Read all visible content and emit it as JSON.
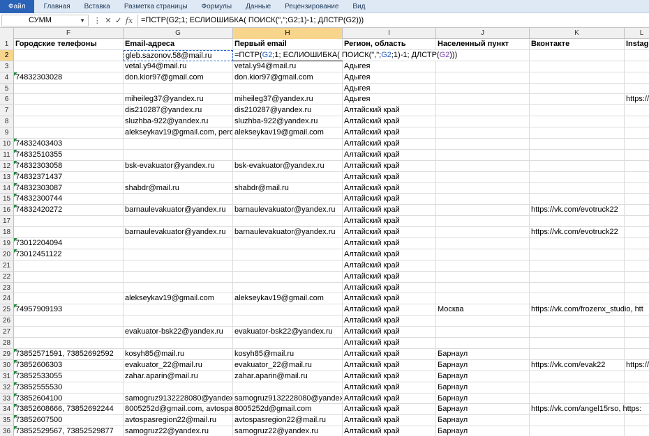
{
  "ribbon": {
    "tabs": [
      "Файл",
      "Главная",
      "Вставка",
      "Разметка страницы",
      "Формулы",
      "Данные",
      "Рецензирование",
      "Вид"
    ]
  },
  "formula_bar": {
    "name_box": "СУММ",
    "cancel": "✕",
    "enter": "✓",
    "fx": "fx",
    "formula": "=ПСТР(G2;1; ЕСЛИОШИБКА( ПОИСК(\",\";G2;1)-1; ДЛСТР(G2)))"
  },
  "columns": [
    "F",
    "G",
    "H",
    "I",
    "J",
    "K",
    "L"
  ],
  "header_row": {
    "F": "Городские телефоны",
    "G": "Email-адреса",
    "H": "Первый email",
    "I": "Регион, область",
    "J": "Населенный пункт",
    "K": "Вконтакте",
    "L": "Instagram"
  },
  "edit_cell_text": "=ПСТР(G2;1; ЕСЛИОШИБКА( ПОИСК(\",\";G2;1)-1; ДЛСТР(G2)))",
  "rows": [
    {
      "n": "2",
      "F": "",
      "G": "gleb.sazonov.58@mail.ru",
      "H": "",
      "I": "",
      "J": "",
      "K": "",
      "L": ""
    },
    {
      "n": "3",
      "F": "",
      "G": "vetal.y94@mail.ru",
      "H": "vetal.y94@mail.ru",
      "I": "Адыгея",
      "J": "",
      "K": "",
      "L": ""
    },
    {
      "n": "4",
      "F": "74832303028",
      "G": "don.kior97@gmail.com",
      "H": "don.kior97@gmail.com",
      "I": "Адыгея",
      "J": "",
      "K": "",
      "L": ""
    },
    {
      "n": "5",
      "F": "",
      "G": "",
      "H": "",
      "I": "Адыгея",
      "J": "",
      "K": "",
      "L": ""
    },
    {
      "n": "6",
      "F": "",
      "G": "miheileg37@yandex.ru",
      "H": "miheileg37@yandex.ru",
      "I": "Адыгея",
      "J": "",
      "K": "",
      "L": "https://"
    },
    {
      "n": "7",
      "F": "",
      "G": "dis210287@yandex.ru",
      "H": "dis210287@yandex.ru",
      "I": "Алтайский край",
      "J": "",
      "K": "",
      "L": ""
    },
    {
      "n": "8",
      "F": "",
      "G": "sluzhba-922@yandex.ru",
      "H": "sluzhba-922@yandex.ru",
      "I": "Алтайский край",
      "J": "",
      "K": "",
      "L": ""
    },
    {
      "n": "9",
      "F": "",
      "G": "alekseykav19@gmail.com, pero",
      "H": "alekseykav19@gmail.com",
      "I": "Алтайский край",
      "J": "",
      "K": "",
      "L": ""
    },
    {
      "n": "10",
      "F": "74832403403",
      "G": "",
      "H": "",
      "I": "Алтайский край",
      "J": "",
      "K": "",
      "L": ""
    },
    {
      "n": "11",
      "F": "74832510355",
      "G": "",
      "H": "",
      "I": "Алтайский край",
      "J": "",
      "K": "",
      "L": ""
    },
    {
      "n": "12",
      "F": "74832303058",
      "G": "bsk-evakuator@yandex.ru",
      "H": "bsk-evakuator@yandex.ru",
      "I": "Алтайский край",
      "J": "",
      "K": "",
      "L": ""
    },
    {
      "n": "13",
      "F": "74832371437",
      "G": "",
      "H": "",
      "I": "Алтайский край",
      "J": "",
      "K": "",
      "L": ""
    },
    {
      "n": "14",
      "F": "74832303087",
      "G": "shabdr@mail.ru",
      "H": "shabdr@mail.ru",
      "I": "Алтайский край",
      "J": "",
      "K": "",
      "L": ""
    },
    {
      "n": "15",
      "F": "74832300744",
      "G": "",
      "H": "",
      "I": "Алтайский край",
      "J": "",
      "K": "",
      "L": ""
    },
    {
      "n": "16",
      "F": "74832420272",
      "G": "barnaulevakuator@yandex.ru",
      "H": "barnaulevakuator@yandex.ru",
      "I": "Алтайский край",
      "J": "",
      "K": "https://vk.com/evotruck22",
      "L": ""
    },
    {
      "n": "17",
      "F": "",
      "G": "",
      "H": "",
      "I": "Алтайский край",
      "J": "",
      "K": "",
      "L": ""
    },
    {
      "n": "18",
      "F": "",
      "G": "barnaulevakuator@yandex.ru",
      "H": "barnaulevakuator@yandex.ru",
      "I": "Алтайский край",
      "J": "",
      "K": "https://vk.com/evotruck22",
      "L": ""
    },
    {
      "n": "19",
      "F": "73012204094",
      "G": "",
      "H": "",
      "I": "Алтайский край",
      "J": "",
      "K": "",
      "L": ""
    },
    {
      "n": "20",
      "F": "73012451122",
      "G": "",
      "H": "",
      "I": "Алтайский край",
      "J": "",
      "K": "",
      "L": ""
    },
    {
      "n": "21",
      "F": "",
      "G": "",
      "H": "",
      "I": "Алтайский край",
      "J": "",
      "K": "",
      "L": ""
    },
    {
      "n": "22",
      "F": "",
      "G": "",
      "H": "",
      "I": "Алтайский край",
      "J": "",
      "K": "",
      "L": ""
    },
    {
      "n": "23",
      "F": "",
      "G": "",
      "H": "",
      "I": "Алтайский край",
      "J": "",
      "K": "",
      "L": ""
    },
    {
      "n": "24",
      "F": "",
      "G": "alekseykav19@gmail.com",
      "H": "alekseykav19@gmail.com",
      "I": "Алтайский край",
      "J": "",
      "K": "",
      "L": ""
    },
    {
      "n": "25",
      "F": "74957909193",
      "G": "",
      "H": "",
      "I": "Алтайский край",
      "J": "Москва",
      "K": "https://vk.com/frozenx_studio, htt",
      "L": ""
    },
    {
      "n": "26",
      "F": "",
      "G": "",
      "H": "",
      "I": "Алтайский край",
      "J": "",
      "K": "",
      "L": ""
    },
    {
      "n": "27",
      "F": "",
      "G": "evakuator-bsk22@yandex.ru",
      "H": "evakuator-bsk22@yandex.ru",
      "I": "Алтайский край",
      "J": "",
      "K": "",
      "L": ""
    },
    {
      "n": "28",
      "F": "",
      "G": "",
      "H": "",
      "I": "Алтайский край",
      "J": "",
      "K": "",
      "L": ""
    },
    {
      "n": "29",
      "F": "73852571591, 73852692592",
      "G": "kosyh85@mail.ru",
      "H": "kosyh85@mail.ru",
      "I": "Алтайский край",
      "J": "Барнаул",
      "K": "",
      "L": ""
    },
    {
      "n": "30",
      "F": "73852606303",
      "G": "evakuator_22@mail.ru",
      "H": "evakuator_22@mail.ru",
      "I": "Алтайский край",
      "J": "Барнаул",
      "K": "https://vk.com/evak22",
      "L": "https://"
    },
    {
      "n": "31",
      "F": "73852533055",
      "G": "zahar.aparin@mail.ru",
      "H": "zahar.aparin@mail.ru",
      "I": "Алтайский край",
      "J": "Барнаул",
      "K": "",
      "L": ""
    },
    {
      "n": "32",
      "F": "73852555530",
      "G": "",
      "H": "",
      "I": "Алтайский край",
      "J": "Барнаул",
      "K": "",
      "L": ""
    },
    {
      "n": "33",
      "F": "73852604100",
      "G": "samogruz9132228080@yandex.r",
      "H": "samogruz9132228080@yandex.r",
      "I": "Алтайский край",
      "J": "Барнаул",
      "K": "",
      "L": ""
    },
    {
      "n": "34",
      "F": "73852608666, 73852692244",
      "G": "8005252d@gmail.com, avtospas",
      "H": "8005252d@gmail.com",
      "I": "Алтайский край",
      "J": "Барнаул",
      "K": "https://vk.com/angel15rso, https:",
      "L": ""
    },
    {
      "n": "35",
      "F": "73852607500",
      "G": "avtospasregion22@mail.ru",
      "H": "avtospasregion22@mail.ru",
      "I": "Алтайский край",
      "J": "Барнаул",
      "K": "",
      "L": ""
    },
    {
      "n": "36",
      "F": "73852529567, 73852529877",
      "G": "samogruz22@yandex.ru",
      "H": "samogruz22@yandex.ru",
      "I": "Алтайский край",
      "J": "Барнаул",
      "K": "",
      "L": ""
    }
  ],
  "green_triangle_rows": [
    "4",
    "10",
    "11",
    "12",
    "13",
    "14",
    "15",
    "16",
    "19",
    "20",
    "25",
    "29",
    "30",
    "31",
    "32",
    "33",
    "34",
    "35",
    "36"
  ],
  "colors": {
    "file_tab": "#2a62b8",
    "selection_header": "#f7d58c",
    "ref_blue": "#1f5fbf",
    "ref_purple": "#7a3fb0",
    "green_flag": "#1f8a3c"
  }
}
